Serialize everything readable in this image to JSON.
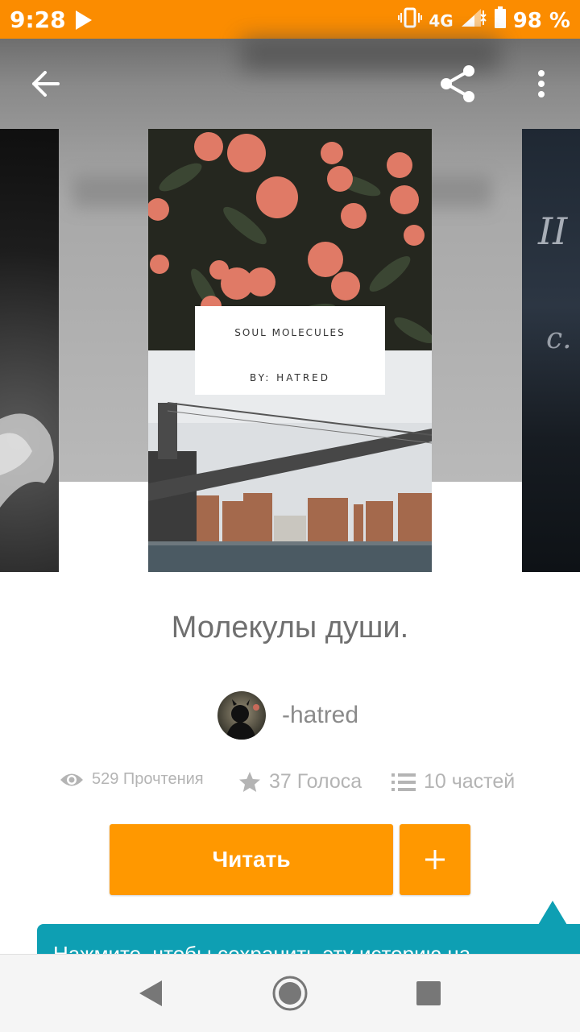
{
  "status_bar": {
    "time": "9:28",
    "network": "4G",
    "battery": "98 %"
  },
  "book": {
    "cover_line1": "SOUL MOLECULES",
    "cover_line2": "BY: HATRED",
    "right_cover_text1": "II",
    "right_cover_text2": "c.",
    "title": "Молекулы души.",
    "author": "-hatred"
  },
  "stats": {
    "reads": "529 Прочтения",
    "votes": "37 Голоса",
    "parts": "10 частей"
  },
  "actions": {
    "read_label": "Читать"
  },
  "tooltip": {
    "text": "Нажмите, чтобы сохранить эту историю на"
  },
  "colors": {
    "accent": "#ff9800",
    "status_bar": "#fb8c00",
    "tooltip": "#0e9fb3"
  }
}
